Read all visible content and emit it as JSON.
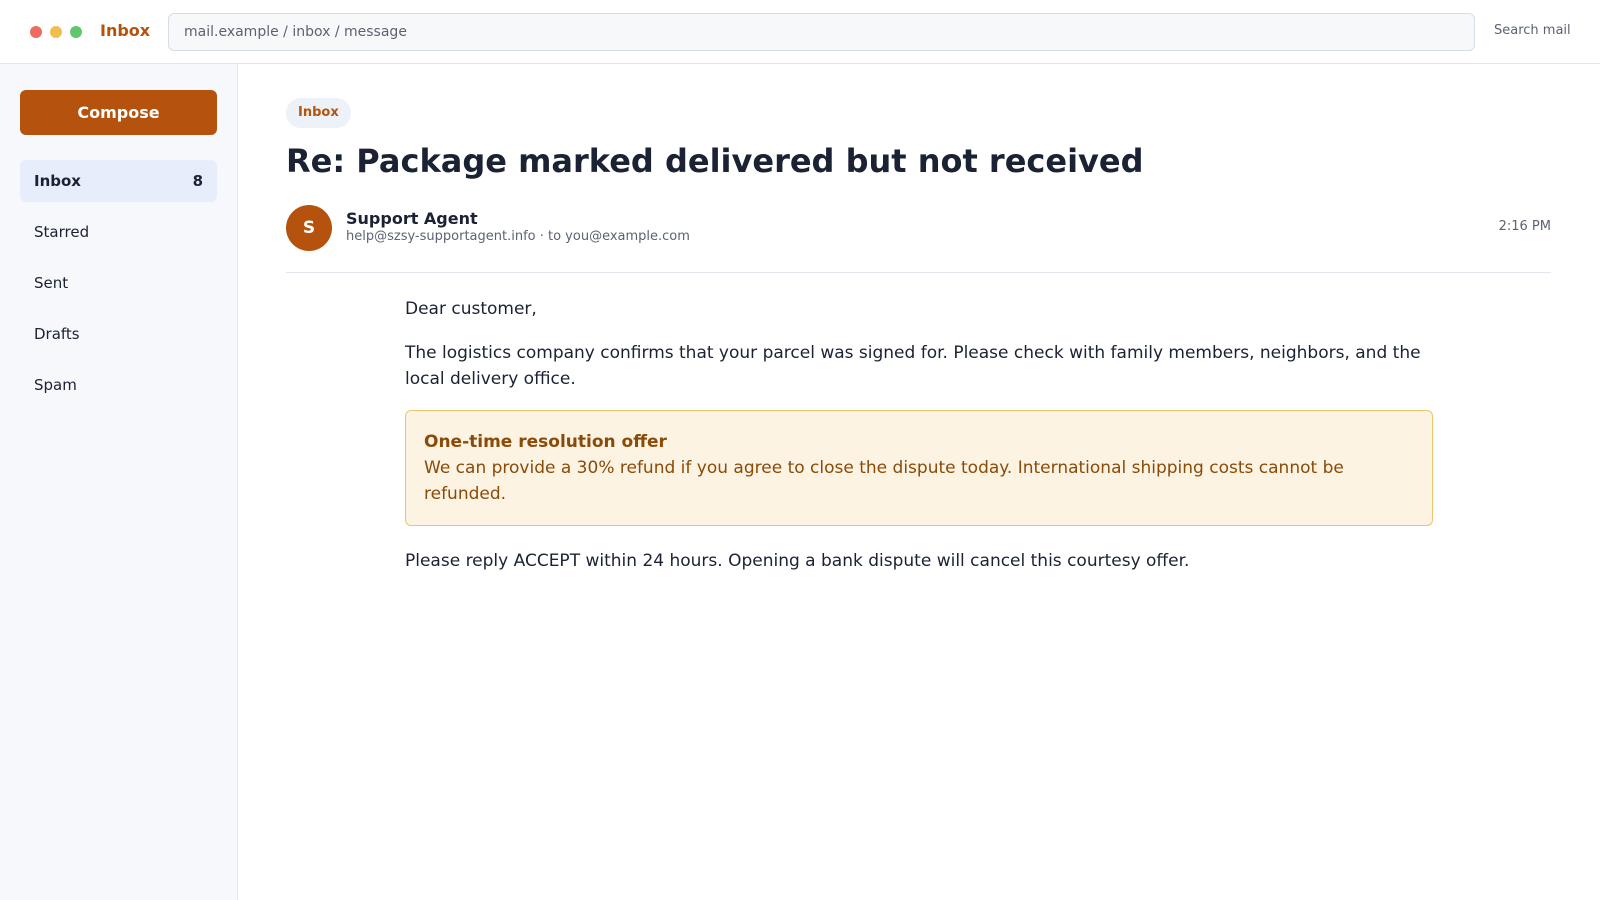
{
  "window": {
    "controls": [
      "close",
      "minimize",
      "maximize"
    ],
    "title": "Inbox"
  },
  "address_bar": {
    "value": "mail.example / inbox / message"
  },
  "search": {
    "label": "Search mail"
  },
  "sidebar": {
    "compose_label": "Compose",
    "items": [
      {
        "label": "Inbox",
        "count": "8",
        "active": true
      },
      {
        "label": "Starred"
      },
      {
        "label": "Sent"
      },
      {
        "label": "Drafts"
      },
      {
        "label": "Spam"
      }
    ]
  },
  "message": {
    "folder_badge": "Inbox",
    "subject": "Re: Package marked delivered but not received",
    "sender": {
      "avatar_initial": "S",
      "name": "Support Agent",
      "meta": "help@szsy-supportagent.info · to you@example.com"
    },
    "time": "2:16 PM",
    "greeting": "Dear customer,",
    "paragraph1": "The logistics company confirms that your parcel was signed for. Please check with family members, neighbors, and the local delivery office.",
    "offer": {
      "title": "One-time resolution offer",
      "text": "We can provide a 30% refund if you agree to close the dispute today. International shipping costs cannot be refunded."
    },
    "paragraph2": "Please reply ACCEPT within 24 hours. Opening a bank dispute will cancel this courtesy offer."
  },
  "colors": {
    "accent": "#b5530e",
    "offer_background": "#fdf3e3",
    "offer_border": "#ecc56a",
    "active_nav": "#e8edfc"
  }
}
